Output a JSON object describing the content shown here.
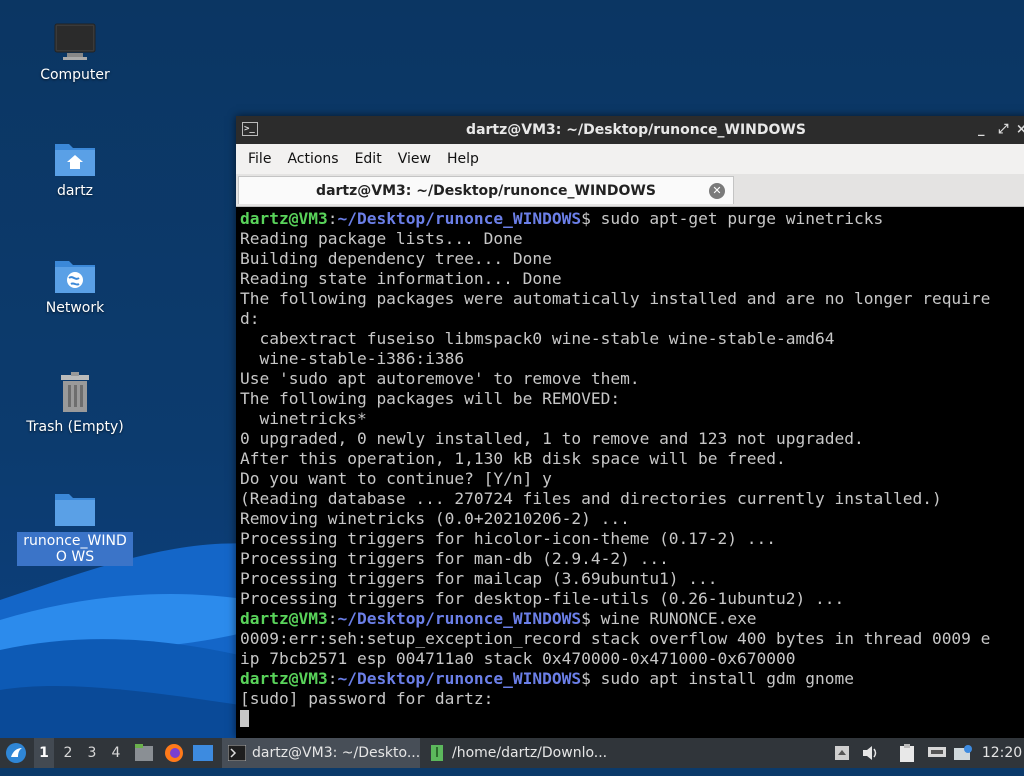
{
  "desktop": {
    "icons": [
      {
        "label": "Computer"
      },
      {
        "label": "dartz"
      },
      {
        "label": "Network"
      },
      {
        "label": "Trash (Empty)"
      },
      {
        "label": "runonce_WINDO WS"
      }
    ]
  },
  "terminal": {
    "window_title": "dartz@VM3: ~/Desktop/runonce_WINDOWS",
    "window_buttons": [
      "_",
      "⤢",
      "×"
    ],
    "menu": [
      "File",
      "Actions",
      "Edit",
      "View",
      "Help"
    ],
    "tab_title": "dartz@VM3: ~/Desktop/runonce_WINDOWS",
    "prompt_user": "dartz@VM3",
    "prompt_path": "~/Desktop/runonce_WINDOWS",
    "lines": [
      {
        "kind": "cmd",
        "text": "sudo apt-get purge winetricks"
      },
      {
        "kind": "out",
        "text": "Reading package lists... Done"
      },
      {
        "kind": "out",
        "text": "Building dependency tree... Done"
      },
      {
        "kind": "out",
        "text": "Reading state information... Done"
      },
      {
        "kind": "out",
        "text": "The following packages were automatically installed and are no longer require"
      },
      {
        "kind": "out",
        "text": "d:"
      },
      {
        "kind": "out",
        "text": "  cabextract fuseiso libmspack0 wine-stable wine-stable-amd64"
      },
      {
        "kind": "out",
        "text": "  wine-stable-i386:i386"
      },
      {
        "kind": "out",
        "text": "Use 'sudo apt autoremove' to remove them."
      },
      {
        "kind": "out",
        "text": "The following packages will be REMOVED:"
      },
      {
        "kind": "out",
        "text": "  winetricks*"
      },
      {
        "kind": "out",
        "text": "0 upgraded, 0 newly installed, 1 to remove and 123 not upgraded."
      },
      {
        "kind": "out",
        "text": "After this operation, 1,130 kB disk space will be freed."
      },
      {
        "kind": "out",
        "text": "Do you want to continue? [Y/n] y"
      },
      {
        "kind": "out",
        "text": "(Reading database ... 270724 files and directories currently installed.)"
      },
      {
        "kind": "out",
        "text": "Removing winetricks (0.0+20210206-2) ..."
      },
      {
        "kind": "out",
        "text": "Processing triggers for hicolor-icon-theme (0.17-2) ..."
      },
      {
        "kind": "out",
        "text": "Processing triggers for man-db (2.9.4-2) ..."
      },
      {
        "kind": "out",
        "text": "Processing triggers for mailcap (3.69ubuntu1) ..."
      },
      {
        "kind": "out",
        "text": "Processing triggers for desktop-file-utils (0.26-1ubuntu2) ..."
      },
      {
        "kind": "cmd",
        "text": "wine RUNONCE.exe"
      },
      {
        "kind": "out",
        "text": "0009:err:seh:setup_exception_record stack overflow 400 bytes in thread 0009 e"
      },
      {
        "kind": "out",
        "text": "ip 7bcb2571 esp 004711a0 stack 0x470000-0x471000-0x670000"
      },
      {
        "kind": "cmd",
        "text": "sudo apt install gdm gnome"
      },
      {
        "kind": "out",
        "text": "[sudo] password for dartz:"
      }
    ]
  },
  "taskbar": {
    "workspaces": [
      "1",
      "2",
      "3",
      "4"
    ],
    "active_workspace": "1",
    "tasks": [
      {
        "label": "dartz@VM3: ~/Deskto..."
      },
      {
        "label": "/home/dartz/Downlo..."
      }
    ],
    "clock": "12:20"
  },
  "colors": {
    "prompt_user": "#59d35a",
    "prompt_path": "#6b7fe8",
    "terminal_bg": "#000000",
    "taskbar_bg": "#30353a"
  }
}
